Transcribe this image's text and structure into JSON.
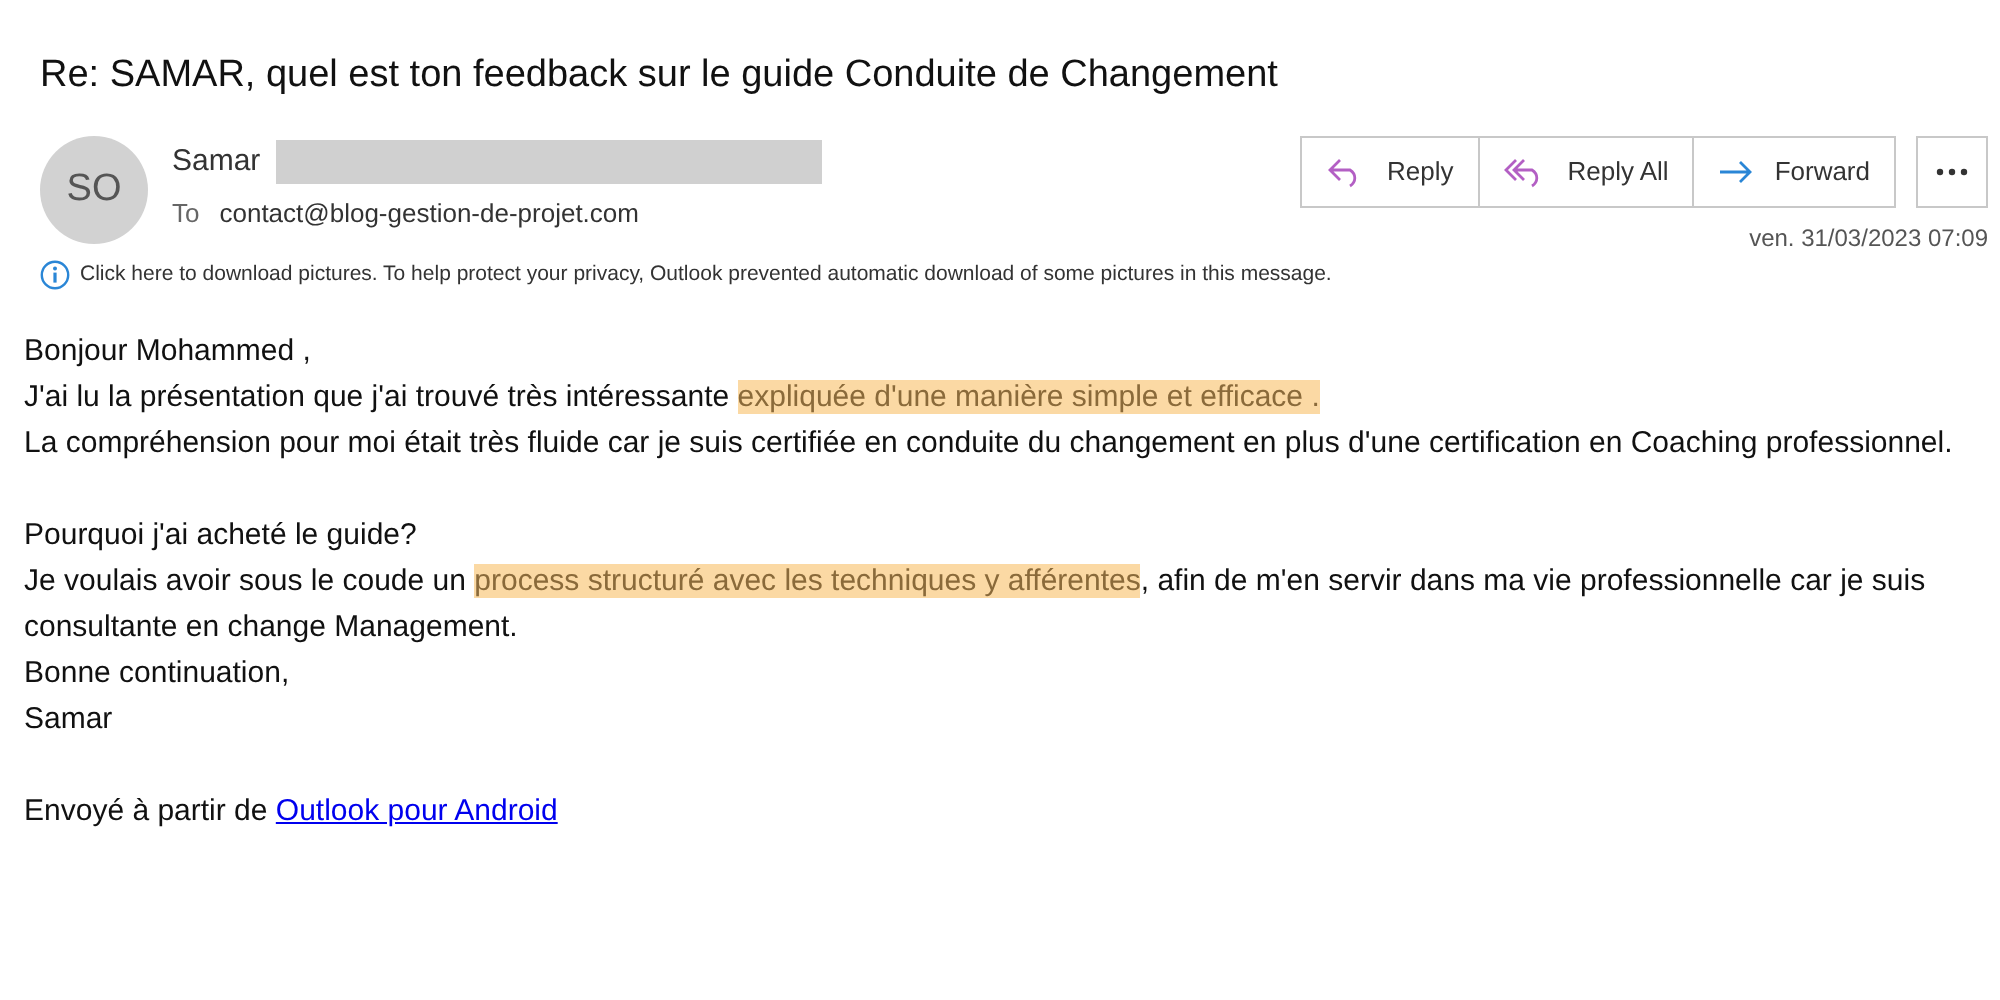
{
  "subject": "Re: SAMAR, quel est ton feedback sur le guide Conduite de Changement",
  "sender": {
    "initials": "SO",
    "name": "Samar",
    "to_label": "To",
    "to": "contact@blog-gestion-de-projet.com"
  },
  "actions": [
    {
      "label": "Reply",
      "kind": "reply"
    },
    {
      "label": "Reply All",
      "kind": "reply_all"
    },
    {
      "label": "Forward",
      "kind": "forward"
    }
  ],
  "date": "ven. 31/03/2023 07:09",
  "info_bar": "Click here to download pictures. To help protect your privacy, Outlook prevented automatic download of some pictures in this message.",
  "body": [
    [
      [
        {
          "kind": "text",
          "text": "Bonjour Mohammed ,"
        }
      ],
      [
        {
          "kind": "text",
          "text": "J'ai lu la présentation que j'ai trouvé très intéressante "
        },
        {
          "kind": "highlight",
          "text": "expliquée d'une manière simple et efficace . "
        }
      ],
      [
        {
          "kind": "text",
          "text": "La compréhension pour moi était très fluide car je suis certifiée en conduite du changement en plus d'une certification en Coaching professionnel."
        }
      ]
    ],
    [
      [
        {
          "kind": "text",
          "text": "Pourquoi j'ai acheté le guide?"
        }
      ],
      [
        {
          "kind": "text",
          "text": "Je voulais avoir sous le coude un "
        },
        {
          "kind": "highlight",
          "text": "process structuré avec les techniques y afférentes"
        },
        {
          "kind": "text",
          "text": ", afin de m'en servir dans ma vie professionnelle car je suis consultante en change Management."
        }
      ],
      [
        {
          "kind": "text",
          "text": "Bonne continuation,"
        }
      ],
      [
        {
          "kind": "text",
          "text": "Samar"
        }
      ]
    ],
    [
      [
        {
          "kind": "text",
          "text": "Envoyé à partir de "
        },
        {
          "kind": "link",
          "text": "Outlook pour Android"
        }
      ]
    ]
  ]
}
